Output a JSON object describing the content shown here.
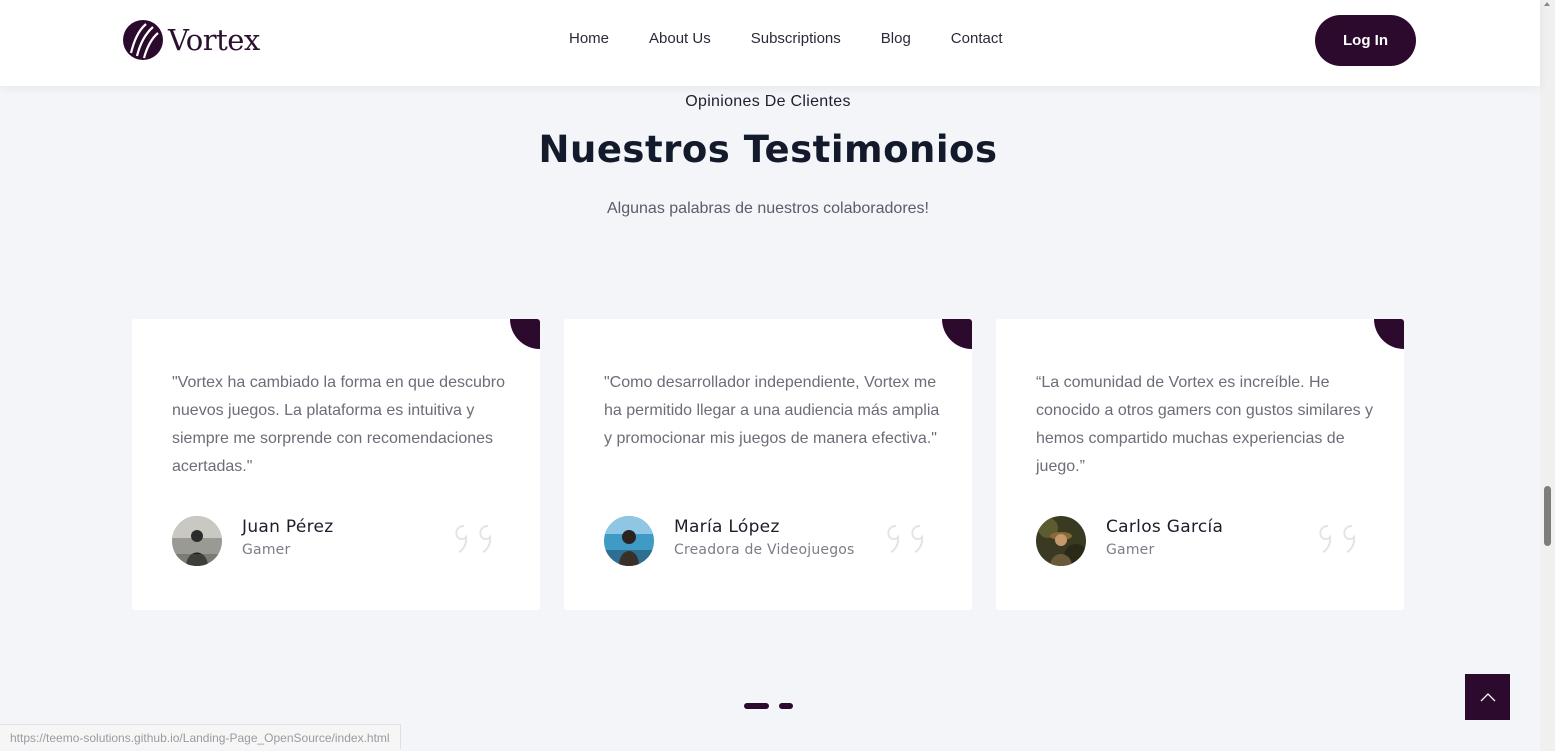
{
  "brand": {
    "name": "Vortex"
  },
  "nav": {
    "items": [
      {
        "label": "Home"
      },
      {
        "label": "About Us"
      },
      {
        "label": "Subscriptions"
      },
      {
        "label": "Blog"
      },
      {
        "label": "Contact"
      }
    ],
    "login_label": "Log In"
  },
  "section": {
    "eyebrow": "Opiniones De Clientes",
    "title": "Nuestros Testimonios",
    "subtitle": "Algunas palabras de nuestros colaboradores!"
  },
  "testimonials": [
    {
      "quote": "\"Vortex ha cambiado la forma en que descubro nuevos juegos. La plataforma es intuitiva y siempre me sorprende con recomendaciones acertadas.\"",
      "name": "Juan Pérez",
      "role": "Gamer"
    },
    {
      "quote": "\"Como desarrollador independiente, Vortex me ha permitido llegar a una audiencia más amplia y promocionar mis juegos de manera efectiva.\"",
      "name": "María López",
      "role": "Creadora de Videojuegos"
    },
    {
      "quote": "“La comunidad de Vortex es increíble. He conocido a otros gamers con gustos similares y hemos compartido muchas experiencias de juego.”",
      "name": "Carlos García",
      "role": "Gamer"
    }
  ],
  "pagination": {
    "pages": 2,
    "active_page": 1
  },
  "status_bar": {
    "url": "https://teemo-solutions.github.io/Landing-Page_OpenSource/index.html"
  },
  "colors": {
    "brand_dark": "#2c0a2e",
    "background": "#f3f5f9",
    "card": "#ffffff"
  },
  "icons": {
    "quote": "quote-icon",
    "back_to_top": "chevron-up-icon",
    "logo": "vortex-logo-icon"
  }
}
